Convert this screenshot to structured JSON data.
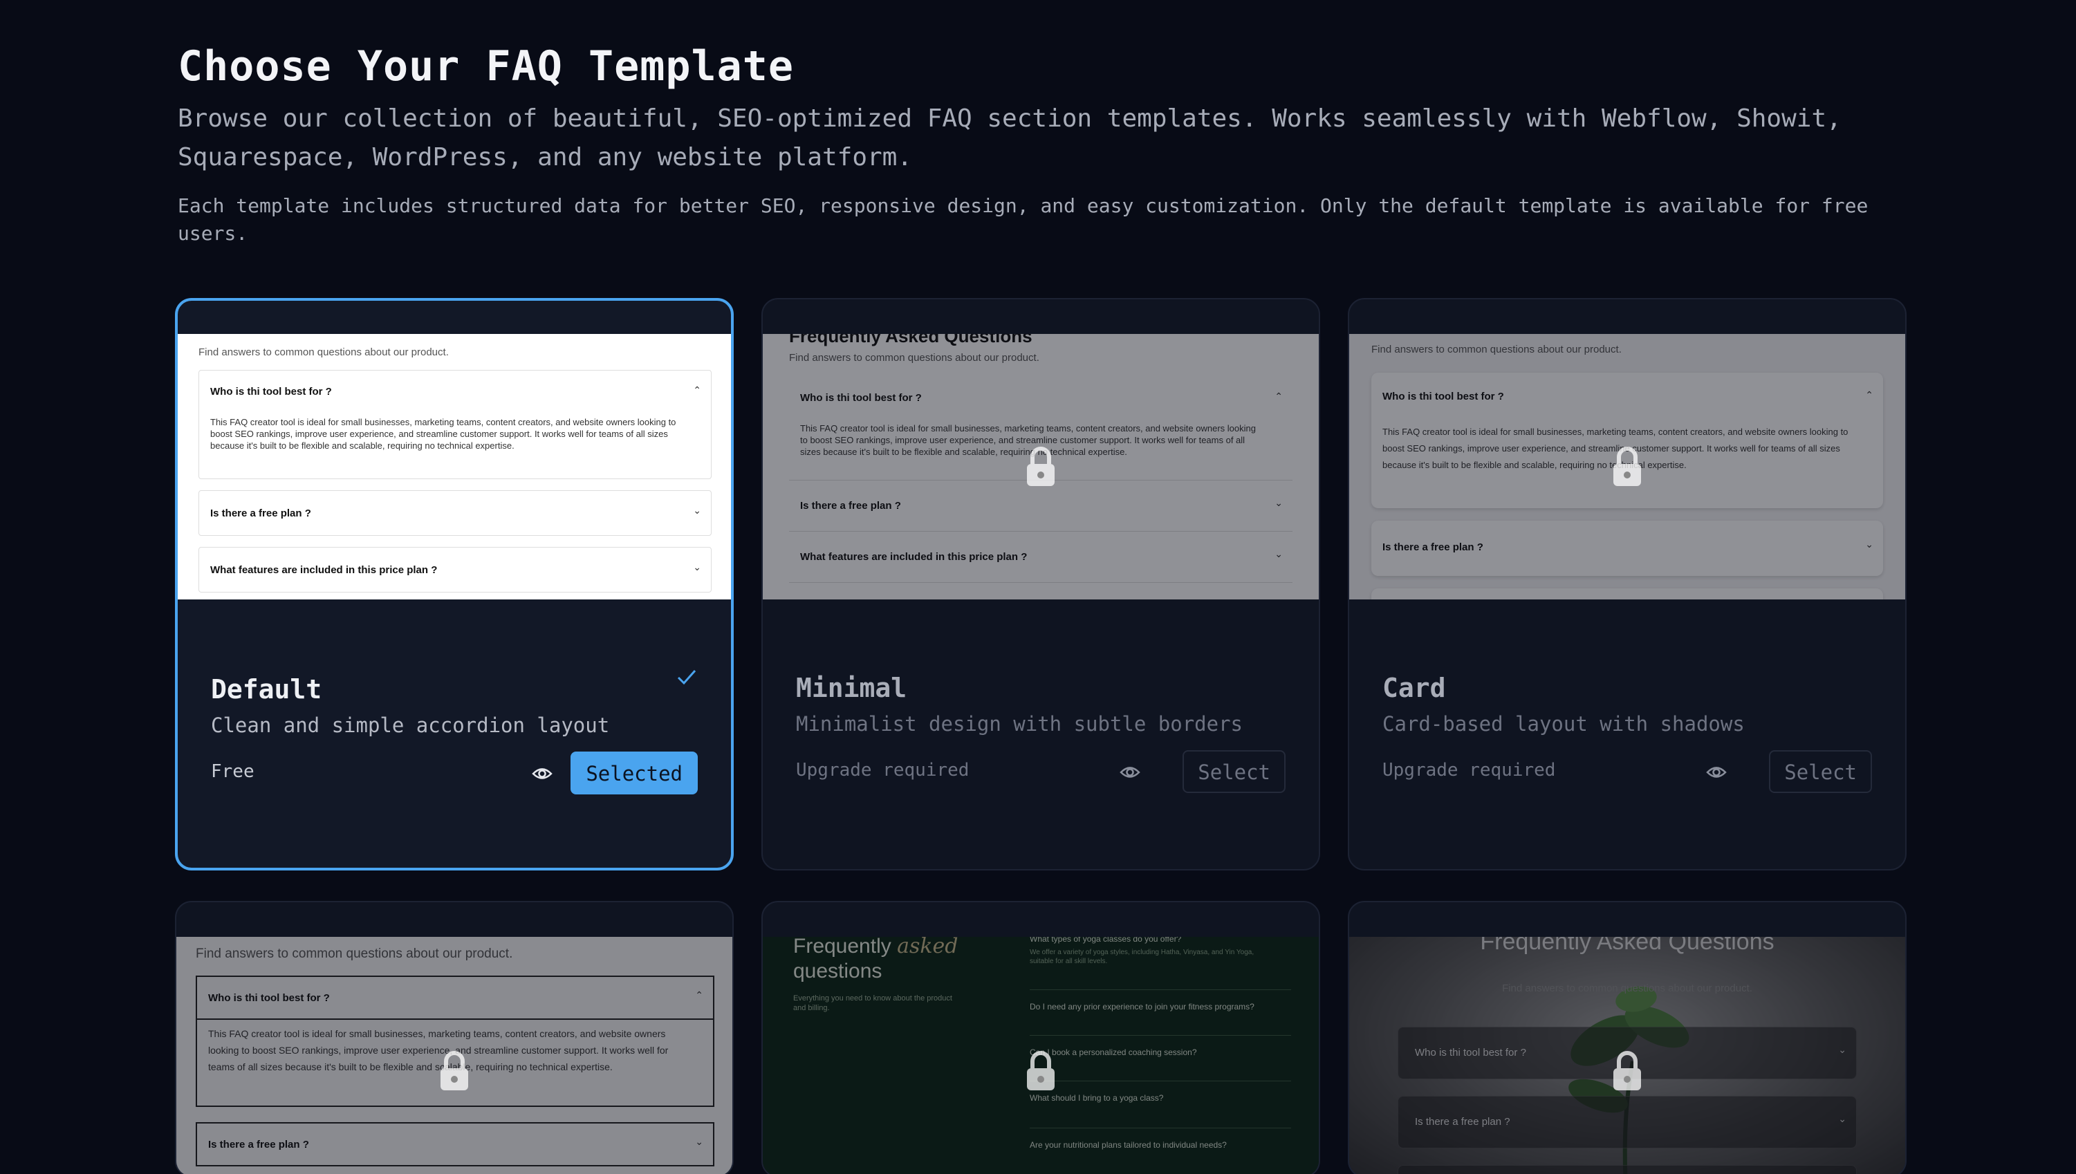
{
  "header": {
    "title": "Choose Your FAQ Template",
    "subtitle": "Browse our collection of beautiful, SEO-optimized FAQ section templates. Works seamlessly with Webflow, Showit, Squarespace, WordPress, and any website platform.",
    "note": "Each template includes structured data for better SEO, responsive design, and easy customization. Only the default template is available for free users."
  },
  "colors": {
    "background": "#080b16",
    "card": "#121827",
    "accent": "#4aa4ef"
  },
  "preview": {
    "heading": "Frequently Asked Questions",
    "heading_alt": "Frequently Asked Questions",
    "sub": "Find answers to common questions about our product.",
    "q1": "Who is thi tool best for ?",
    "a1": "This FAQ creator tool is ideal for small businesses, marketing teams, content creators, and website owners looking to boost SEO rankings, improve user experience, and streamline customer support. It works well for teams of all sizes because it's built to be flexible and scalable, requiring no technical expertise.",
    "q2": "Is there a free plan ?",
    "q3": "What features are included in this price plan ?",
    "yoga_title_1": "Frequently",
    "yoga_title_2": "asked",
    "yoga_title_3": "questions",
    "yoga_sub": "Everything you need to know about the product and billing.",
    "yoga_q1": "What types of yoga classes do you offer?",
    "yoga_a1": "We offer a variety of yoga styles, including Hatha, Vinyasa, and Yin Yoga, suitable for all skill levels.",
    "yoga_q2": "Do I need any prior experience to join your fitness programs?",
    "yoga_q3": "Can I book a personalized coaching session?",
    "yoga_q4": "What should I bring to a yoga class?",
    "yoga_q5": "Are your nutritional plans tailored to individual needs?"
  },
  "templates": [
    {
      "name": "Default",
      "desc": "Clean and simple accordion layout",
      "price": "Free",
      "button": "Selected"
    },
    {
      "name": "Minimal",
      "desc": "Minimalist design with subtle borders",
      "price": "Upgrade required",
      "button": "Select"
    },
    {
      "name": "Card",
      "desc": "Card-based layout with shadows",
      "price": "Upgrade required",
      "button": "Select"
    }
  ]
}
